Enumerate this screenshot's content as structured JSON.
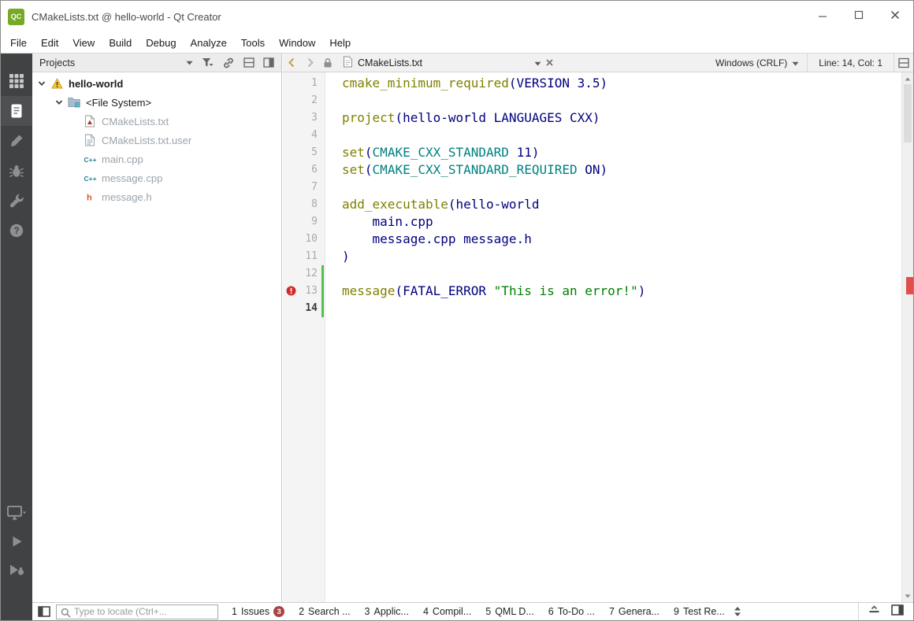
{
  "window": {
    "title": "CMakeLists.txt @ hello-world - Qt Creator",
    "logo_text": "QC"
  },
  "menu": {
    "items": [
      "File",
      "Edit",
      "View",
      "Build",
      "Debug",
      "Analyze",
      "Tools",
      "Window",
      "Help"
    ]
  },
  "sidebar": {
    "modes": [
      {
        "name": "welcome",
        "active": false
      },
      {
        "name": "edit",
        "active": true
      },
      {
        "name": "design",
        "active": false
      },
      {
        "name": "debug",
        "active": false
      },
      {
        "name": "projects",
        "active": false
      },
      {
        "name": "help",
        "active": false
      }
    ],
    "bottom": [
      {
        "name": "kit-selector",
        "icon": "kit"
      },
      {
        "name": "run",
        "icon": "run"
      },
      {
        "name": "debug-run",
        "icon": "debugrun"
      }
    ]
  },
  "projects_panel": {
    "title": "Projects",
    "tree": [
      {
        "label": "hello-world",
        "depth": 0,
        "icon": "warning",
        "chevron": true,
        "style": "root"
      },
      {
        "label": "<File System>",
        "depth": 1,
        "icon": "folder",
        "chevron": true,
        "style": "node"
      },
      {
        "label": "CMakeLists.txt",
        "depth": 2,
        "icon": "cmake-file",
        "chevron": false,
        "style": "file"
      },
      {
        "label": "CMakeLists.txt.user",
        "depth": 2,
        "icon": "user-file",
        "chevron": false,
        "style": "file"
      },
      {
        "label": "main.cpp",
        "depth": 2,
        "icon": "cpp-file",
        "chevron": false,
        "style": "file"
      },
      {
        "label": "message.cpp",
        "depth": 2,
        "icon": "cpp-file",
        "chevron": false,
        "style": "file"
      },
      {
        "label": "message.h",
        "depth": 2,
        "icon": "header-file",
        "chevron": false,
        "style": "file"
      }
    ]
  },
  "editor": {
    "tab_label": "CMakeLists.txt",
    "line_ending": "Windows (CRLF)",
    "cursor_position": "Line: 14, Col: 1",
    "colors": {
      "command": "#808000",
      "variable": "#008080",
      "string": "#008000",
      "plain": "#00007f"
    },
    "code_lines": [
      {
        "num": 1,
        "tokens": [
          [
            "cmd",
            "cmake_minimum_required"
          ],
          [
            "pl",
            "(VERSION 3.5)"
          ]
        ]
      },
      {
        "num": 2,
        "tokens": []
      },
      {
        "num": 3,
        "tokens": [
          [
            "cmd",
            "project"
          ],
          [
            "pl",
            "(hello-world LANGUAGES CXX)"
          ]
        ]
      },
      {
        "num": 4,
        "tokens": []
      },
      {
        "num": 5,
        "tokens": [
          [
            "cmd",
            "set"
          ],
          [
            "pl",
            "("
          ],
          [
            "var",
            "CMAKE_CXX_STANDARD"
          ],
          [
            "pl",
            " 11)"
          ]
        ]
      },
      {
        "num": 6,
        "tokens": [
          [
            "cmd",
            "set"
          ],
          [
            "pl",
            "("
          ],
          [
            "var",
            "CMAKE_CXX_STANDARD_REQUIRED"
          ],
          [
            "pl",
            " ON)"
          ]
        ]
      },
      {
        "num": 7,
        "tokens": []
      },
      {
        "num": 8,
        "tokens": [
          [
            "cmd",
            "add_executable"
          ],
          [
            "pl",
            "(hello-world"
          ]
        ]
      },
      {
        "num": 9,
        "tokens": [
          [
            "pl",
            "    main.cpp"
          ]
        ]
      },
      {
        "num": 10,
        "tokens": [
          [
            "pl",
            "    message.cpp message.h"
          ]
        ]
      },
      {
        "num": 11,
        "tokens": [
          [
            "pl",
            ")"
          ]
        ]
      },
      {
        "num": 12,
        "tokens": [],
        "changed": true
      },
      {
        "num": 13,
        "tokens": [
          [
            "cmd",
            "message"
          ],
          [
            "pl",
            "(FATAL_ERROR "
          ],
          [
            "str",
            "\"This is an error!\""
          ],
          [
            "pl",
            ")"
          ]
        ],
        "changed": true,
        "error": true
      },
      {
        "num": 14,
        "tokens": [],
        "changed": true,
        "current": true
      }
    ]
  },
  "status_bar": {
    "locator_placeholder": "Type to locate (Ctrl+...",
    "output_panes": [
      {
        "key": "1",
        "label": "Issues",
        "badge": "3"
      },
      {
        "key": "2",
        "label": "Search ..."
      },
      {
        "key": "3",
        "label": "Applic..."
      },
      {
        "key": "4",
        "label": "Compil..."
      },
      {
        "key": "5",
        "label": "QML D..."
      },
      {
        "key": "6",
        "label": "To-Do ..."
      },
      {
        "key": "7",
        "label": "Genera..."
      },
      {
        "key": "9",
        "label": "Test Re..."
      }
    ]
  }
}
